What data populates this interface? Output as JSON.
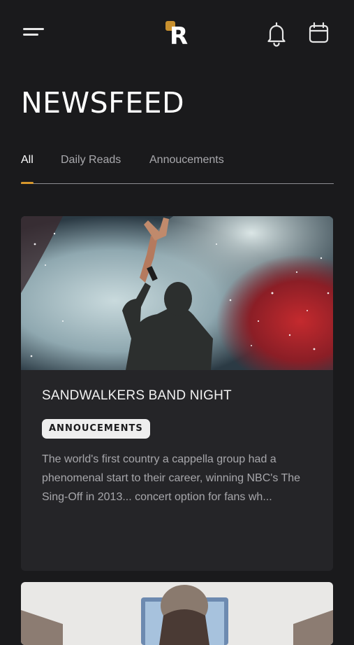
{
  "header": {
    "logo_letter": "R",
    "menu_icon": "hamburger-menu-icon",
    "bell_icon": "bell-icon",
    "calendar_icon": "calendar-icon"
  },
  "page": {
    "title": "NEWSFEED"
  },
  "tabs": [
    {
      "label": "All",
      "active": true
    },
    {
      "label": "Daily Reads",
      "active": false
    },
    {
      "label": "Annoucements",
      "active": false
    }
  ],
  "feed": [
    {
      "title": "SANDWALKERS BAND NIGHT",
      "tag": "ANNOUCEMENTS",
      "description": "The world's first country a cappella group had a phenomenal start to their career, winning NBC's The Sing-Off in 2013... concert option for fans wh..."
    }
  ],
  "colors": {
    "background": "#1a1a1c",
    "card": "#252528",
    "accent": "#d7972c",
    "logo_accent": "#c8902e",
    "badge_bg": "#eeeeee"
  }
}
